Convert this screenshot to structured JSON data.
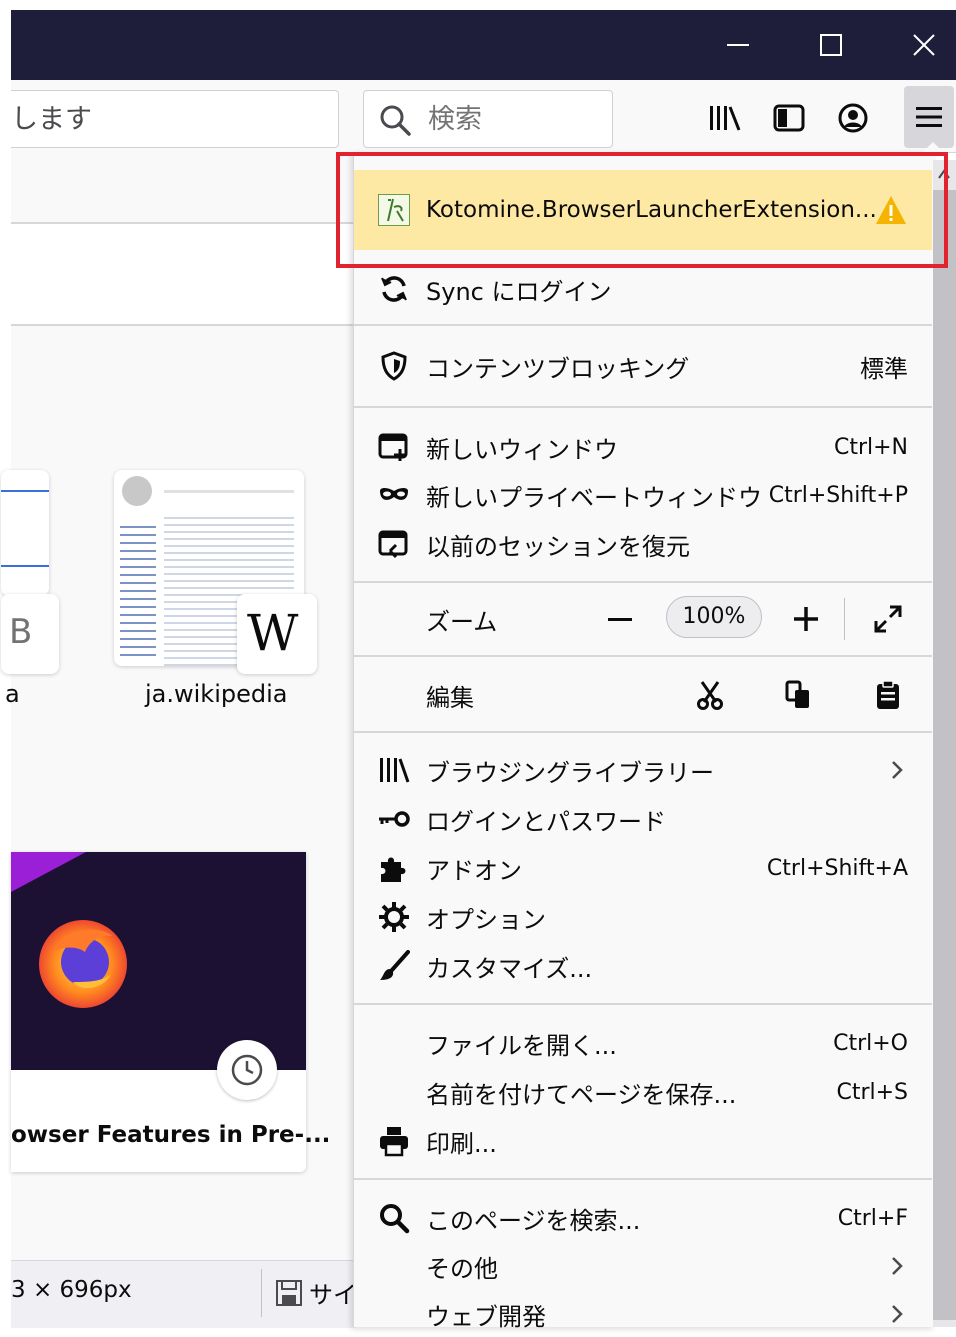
{
  "toolbar": {
    "url_text": "します",
    "search_placeholder": "検索"
  },
  "page": {
    "tile_b_letter": "B",
    "tile_left_label": "a",
    "tile_wiki_label": "ja.wikipedia",
    "wiki_letter": "W",
    "card_title": "owser Features in Pre-...",
    "status_size": "3 × 696px",
    "status_save": "サイ"
  },
  "menu": {
    "extension_label": "Kotomine.BrowserLauncherExtension...",
    "sync_label": "Sync にログイン",
    "content_blocking": {
      "label": "コンテンツブロッキング",
      "value": "標準"
    },
    "new_window": {
      "label": "新しいウィンドウ",
      "shortcut": "Ctrl+N"
    },
    "private_window": {
      "label": "新しいプライベートウィンドウ",
      "shortcut": "Ctrl+Shift+P"
    },
    "restore_session": {
      "label": "以前のセッションを復元"
    },
    "zoom": {
      "label": "ズーム",
      "value": "100%",
      "minus": "−",
      "plus": "+"
    },
    "edit": {
      "label": "編集"
    },
    "library": {
      "label": "ブラウジングライブラリー"
    },
    "logins": {
      "label": "ログインとパスワード"
    },
    "addons": {
      "label": "アドオン",
      "shortcut": "Ctrl+Shift+A"
    },
    "options": {
      "label": "オプション"
    },
    "customize": {
      "label": "カスタマイズ..."
    },
    "open_file": {
      "label": "ファイルを開く...",
      "shortcut": "Ctrl+O"
    },
    "save_page": {
      "label": "名前を付けてページを保存...",
      "shortcut": "Ctrl+S"
    },
    "print": {
      "label": "印刷..."
    },
    "find": {
      "label": "このページを検索...",
      "shortcut": "Ctrl+F"
    },
    "more": {
      "label": "その他"
    },
    "webdev": {
      "label": "ウェブ開発"
    }
  },
  "colors": {
    "titlebar": "#1f1e3a",
    "extension_warning_bg": "#fde9a4",
    "warning_icon": "#f5b400",
    "highlight_border": "#e0232e"
  }
}
